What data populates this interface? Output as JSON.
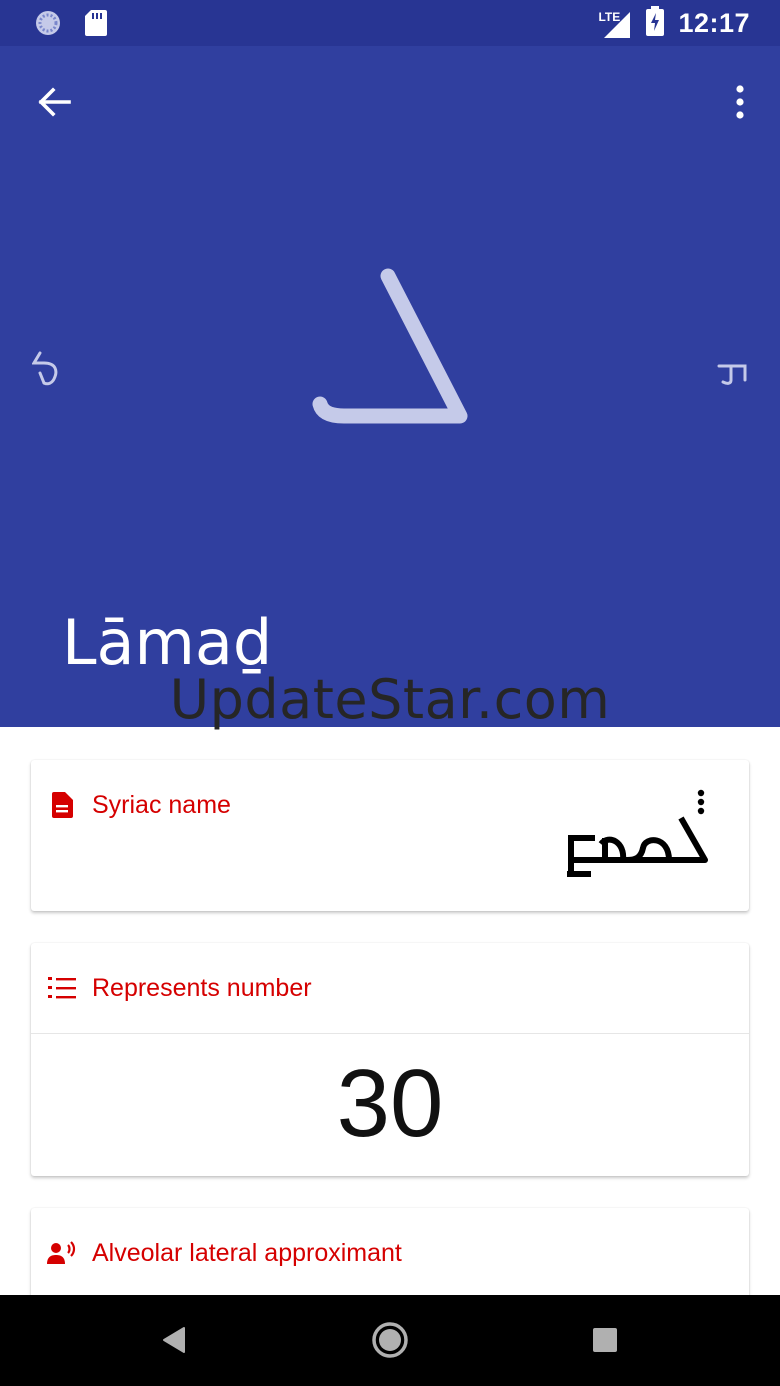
{
  "status": {
    "network": "LTE",
    "time": "12:17"
  },
  "header": {
    "letter": "ܠ",
    "prev_letter": "ܟ",
    "next_letter": "ܡ",
    "letter_name": "Lāmaḏ"
  },
  "watermark": "UpdateStar.com",
  "cards": {
    "syriac_name": {
      "title": "Syriac name",
      "value": "ܠܡܕ"
    },
    "number": {
      "title": "Represents number",
      "value": "30"
    },
    "sound": {
      "title": "Alveolar lateral approximant"
    }
  },
  "colors": {
    "status_bar": "#283593",
    "header": "#303f9f",
    "accent": "#d50000"
  },
  "icons": [
    "sync-icon",
    "sd-card-icon",
    "signal-icon",
    "battery-icon",
    "back-arrow-icon",
    "more-vert-icon",
    "document-icon",
    "numbered-list-icon",
    "voice-icon",
    "nav-back-icon",
    "nav-home-icon",
    "nav-recents-icon"
  ]
}
